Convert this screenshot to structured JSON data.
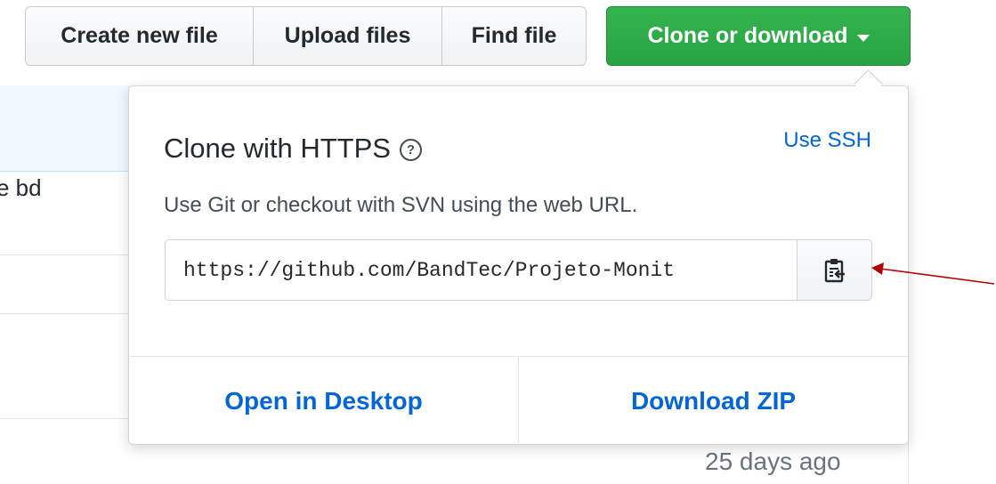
{
  "toolbar": {
    "create_label": "Create new file",
    "upload_label": "Upload files",
    "find_label": "Find file",
    "clone_label": "Clone or download"
  },
  "clone_panel": {
    "title": "Clone with HTTPS",
    "help_icon": "?",
    "use_ssh_label": "Use SSH",
    "description": "Use Git or checkout with SVN using the web URL.",
    "url_value": "https://github.com/BandTec/Projeto-Monit",
    "open_desktop_label": "Open in Desktop",
    "download_zip_label": "Download ZIP"
  },
  "background": {
    "row_text_fragment": "e bd",
    "timestamp": "25 days ago"
  },
  "icons": {
    "clipboard": "clipboard-icon",
    "caret": "caret-down-icon",
    "help": "question-icon",
    "annotation": "red-arrow"
  },
  "colors": {
    "green": "#28a443",
    "link_blue": "#0366d6",
    "annotation_red": "#b30000"
  }
}
